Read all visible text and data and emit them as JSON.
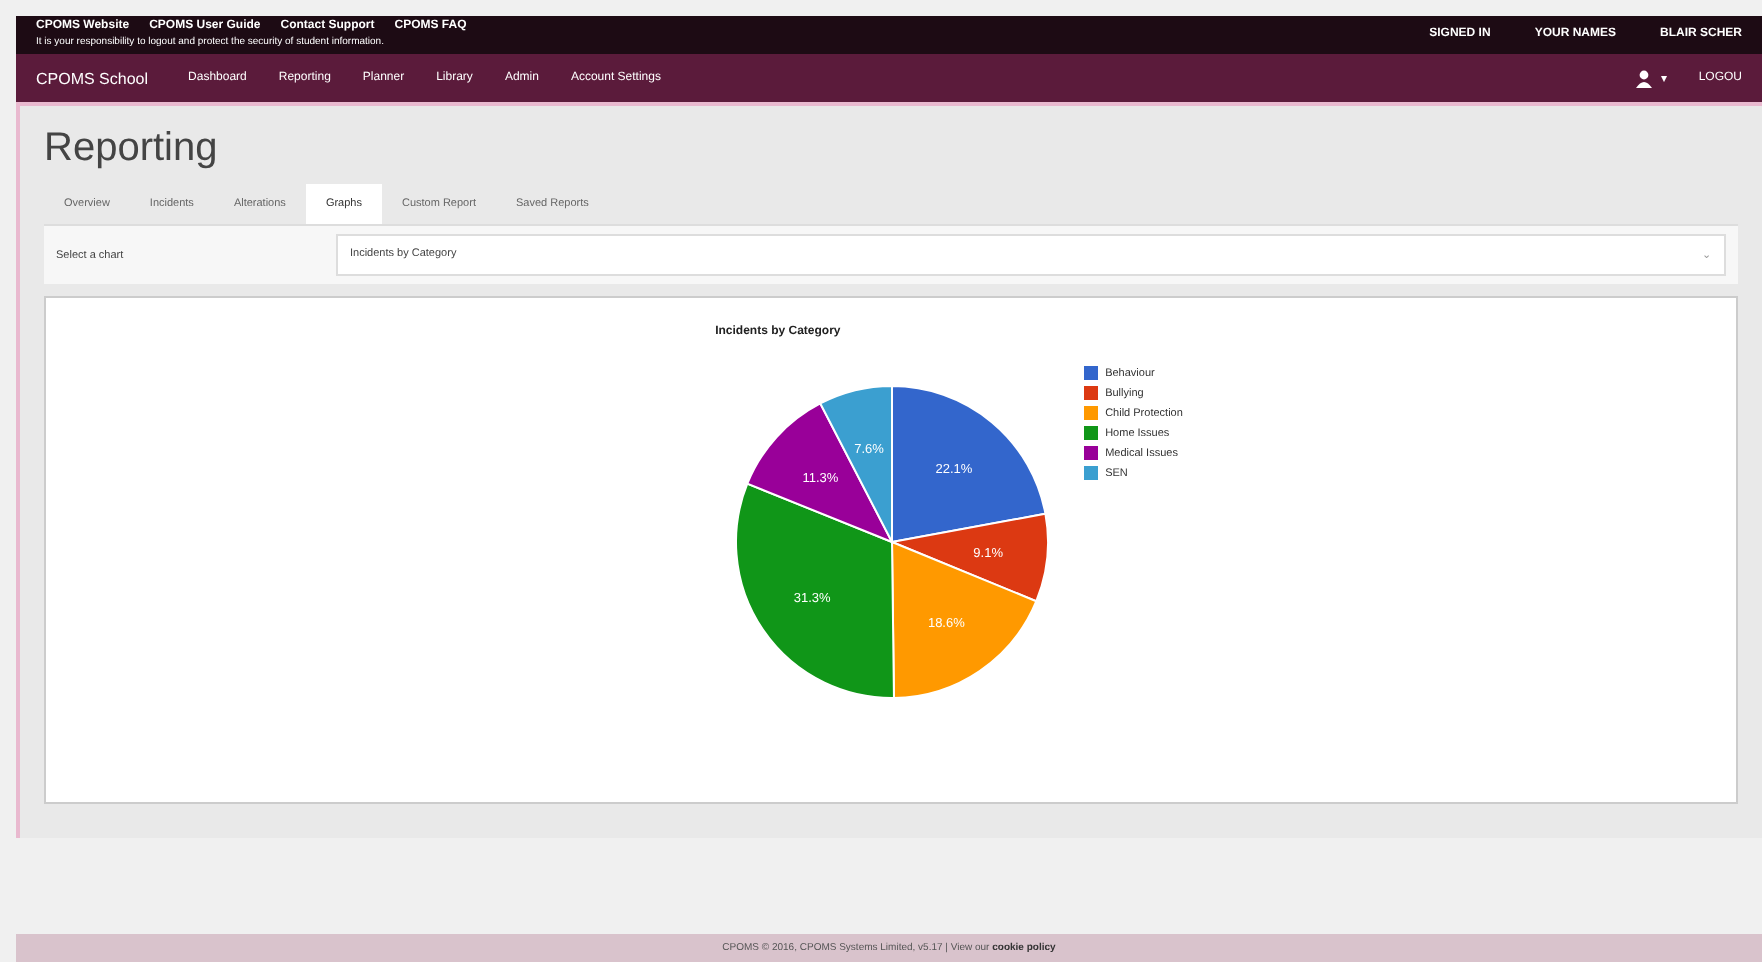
{
  "top_links": [
    "CPOMS Website",
    "CPOMS User Guide",
    "Contact Support",
    "CPOMS FAQ"
  ],
  "notice": "It is your responsibility to logout and protect the security of student information.",
  "top_right": [
    "SIGNED IN",
    "YOUR NAMES",
    "BLAIR SCHER"
  ],
  "brand": "CPOMS School",
  "nav": [
    "Dashboard",
    "Reporting",
    "Planner",
    "Library",
    "Admin",
    "Account Settings"
  ],
  "nav_right": {
    "user_caret": "▾",
    "logout": "LOGOU"
  },
  "page_title": "Reporting",
  "tabs": [
    {
      "label": "Overview",
      "selected": false
    },
    {
      "label": "Incidents",
      "selected": false
    },
    {
      "label": "Alterations",
      "selected": false
    },
    {
      "label": "Graphs",
      "selected": true
    },
    {
      "label": "Custom Report",
      "selected": false
    },
    {
      "label": "Saved Reports",
      "selected": false
    }
  ],
  "chart_select": {
    "label": "Select a chart",
    "value": "Incidents by Category",
    "caret": "⌄"
  },
  "chart_data": {
    "type": "pie",
    "title": "Incidents by Category",
    "categories": [
      "Behaviour",
      "Bullying",
      "Child Protection",
      "Home Issues",
      "Medical Issues",
      "SEN"
    ],
    "series": [
      {
        "values": [
          22.1,
          9.1,
          18.6,
          31.3,
          11.3,
          7.6
        ]
      }
    ],
    "colors": [
      "#3366cc",
      "#dc3912",
      "#ff9900",
      "#109618",
      "#990099",
      "#3b9fd0"
    ],
    "value_labels": [
      "22.1%",
      "9.1%",
      "18.6%",
      "31.3%",
      "11.3%",
      "7.6%"
    ],
    "legend": true
  },
  "footer": {
    "text": "CPOMS © 2016, CPOMS Systems Limited, v5.17 | View our",
    "link": "cookie policy"
  }
}
